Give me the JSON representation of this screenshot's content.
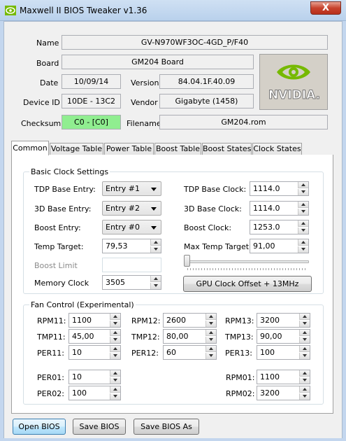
{
  "window": {
    "title": "Maxwell II BIOS Tweaker v1.36",
    "close_label": "X"
  },
  "info": {
    "name_label": "Name",
    "name_value": "GV-N970WF3OC-4GD_P/F40",
    "board_label": "Board",
    "board_value": "GM204 Board",
    "date_label": "Date",
    "date_value": "10/09/14",
    "version_label": "Version",
    "version_value": "84.04.1F.40.09",
    "device_label": "Device ID",
    "device_value": "10DE - 13C2",
    "vendor_label": "Vendor",
    "vendor_value": "Gigabyte (1458)",
    "checksum_label": "Checksum",
    "checksum_value": "C0 - [C0]",
    "filename_label": "Filename",
    "filename_value": "GM204.rom",
    "logo_text": "NVIDIA.",
    "checksum_color": "#90ee90"
  },
  "tabs": [
    "Common",
    "Voltage Table",
    "Power Table",
    "Boost Table",
    "Boost States",
    "Clock States"
  ],
  "basic": {
    "title": "Basic Clock Settings",
    "tdp_entry_label": "TDP Base Entry:",
    "tdp_entry_value": "Entry #1",
    "d3_entry_label": "3D Base Entry:",
    "d3_entry_value": "Entry #2",
    "boost_entry_label": "Boost Entry:",
    "boost_entry_value": "Entry #0",
    "temp_target_label": "Temp Target:",
    "temp_target_value": "79,53",
    "boost_limit_label": "Boost Limit",
    "memory_clock_label": "Memory Clock",
    "memory_clock_value": "3505",
    "tdp_clock_label": "TDP Base Clock:",
    "tdp_clock_value": "1114.0",
    "d3_clock_label": "3D Base Clock:",
    "d3_clock_value": "1114.0",
    "boost_clock_label": "Boost Clock:",
    "boost_clock_value": "1253.0",
    "max_temp_label": "Max Temp Target:",
    "max_temp_value": "91,00",
    "offset_button": "GPU Clock Offset + 13MHz",
    "offset_slider_fraction": 0
  },
  "fan": {
    "title": "Fan Control (Experimental)",
    "rpm11_label": "RPM11:",
    "rpm11": "1100",
    "rpm12_label": "RPM12:",
    "rpm12": "2600",
    "rpm13_label": "RPM13:",
    "rpm13": "3200",
    "tmp11_label": "TMP11:",
    "tmp11": "45,00",
    "tmp12_label": "TMP12:",
    "tmp12": "80,00",
    "tmp13_label": "TMP13:",
    "tmp13": "90,00",
    "per11_label": "PER11:",
    "per11": "10",
    "per12_label": "PER12:",
    "per12": "60",
    "per13_label": "PER13:",
    "per13": "100",
    "per01_label": "PER01:",
    "per01": "10",
    "per02_label": "PER02:",
    "per02": "100",
    "rpm01_label": "RPM01:",
    "rpm01": "1100",
    "rpm02_label": "RPM02:",
    "rpm02": "3200"
  },
  "buttons": {
    "open": "Open BIOS",
    "save": "Save BIOS",
    "save_as": "Save BIOS As"
  }
}
